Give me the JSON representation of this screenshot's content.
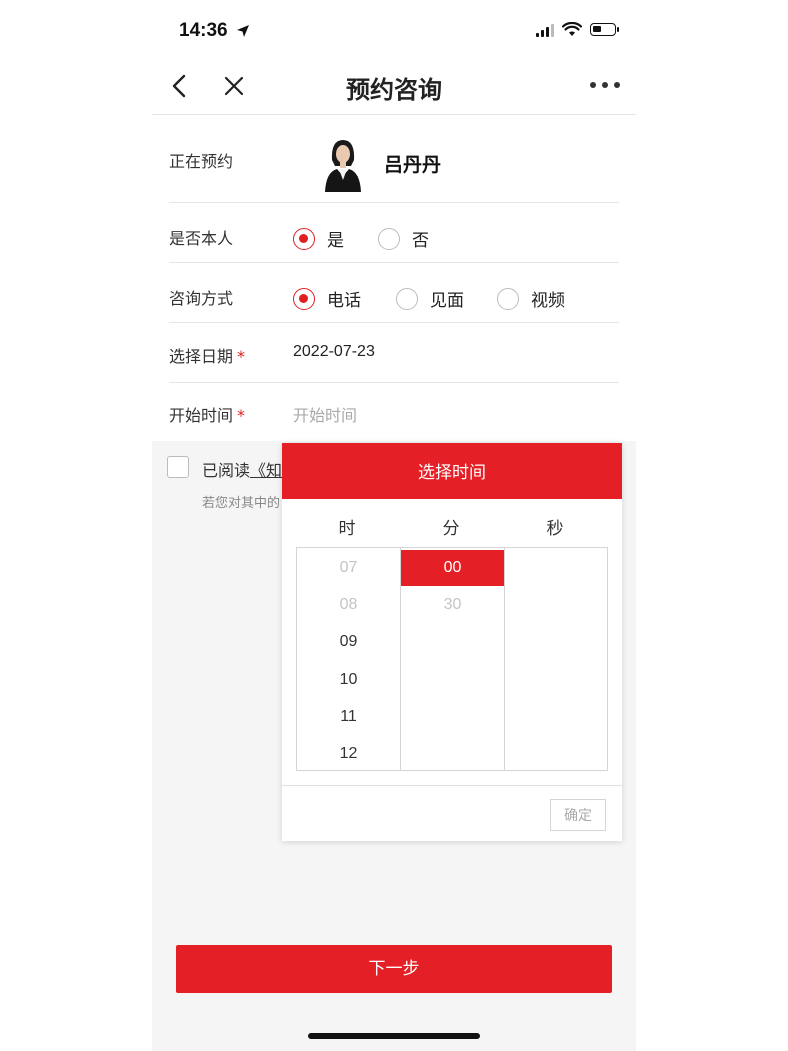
{
  "status_bar": {
    "time": "14:36"
  },
  "nav": {
    "title": "预约咨询"
  },
  "form": {
    "reserving_label": "正在预约",
    "person_name": "吕丹丹",
    "self_label": "是否本人",
    "self_options": [
      "是",
      "否"
    ],
    "self_selected": "是",
    "method_label": "咨询方式",
    "method_options": [
      "电话",
      "见面",
      "视频"
    ],
    "method_selected": "电话",
    "date_label": "选择日期",
    "date_value": "2022-07-23",
    "start_label": "开始时间",
    "start_placeholder": "开始时间",
    "required_mark": "*"
  },
  "agreement": {
    "prefix": "已阅读",
    "link": "《知",
    "note": "若您对其中的"
  },
  "next_button": "下一步",
  "time_picker": {
    "title": "选择时间",
    "columns": [
      "时",
      "分",
      "秒"
    ],
    "hours": [
      "07",
      "08",
      "09",
      "10",
      "11",
      "12"
    ],
    "minutes": [
      "00",
      "30"
    ],
    "selected_minute": "00",
    "confirm": "确定"
  },
  "colors": {
    "accent": "#e42026",
    "background": "#f5f5f5"
  }
}
